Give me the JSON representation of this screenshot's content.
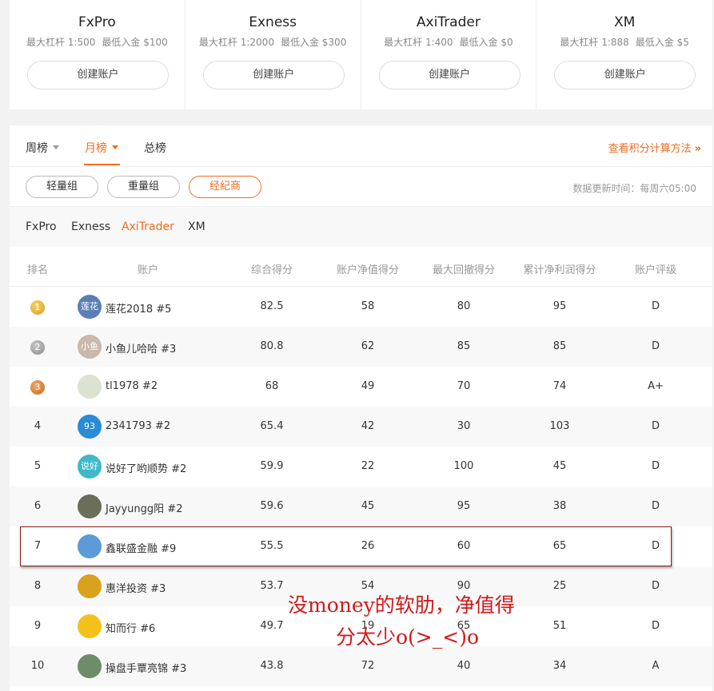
{
  "brokers": [
    {
      "name": "FxPro",
      "leverage": "最大杠杆 1:500",
      "min_deposit": "最低入金 $100",
      "button": "创建账户"
    },
    {
      "name": "Exness",
      "leverage": "最大杠杆 1:2000",
      "min_deposit": "最低入金 $300",
      "button": "创建账户"
    },
    {
      "name": "AxiTrader",
      "leverage": "最大杠杆 1:400",
      "min_deposit": "最低入金 $0",
      "button": "创建账户"
    },
    {
      "name": "XM",
      "leverage": "最大杠杆 1:888",
      "min_deposit": "最低入金 $5",
      "button": "创建账户"
    }
  ],
  "tabs": {
    "weekly": "周榜",
    "monthly": "月榜",
    "overall": "总榜",
    "active": "monthly"
  },
  "score_link": {
    "label": "查看积分计算方法",
    "arrows": "»"
  },
  "groups": {
    "light": "轻量组",
    "heavy": "重量组",
    "broker": "经纪商",
    "active": "broker"
  },
  "update_time": "数据更新时间：每周六05:00",
  "broker_filters": {
    "items": [
      "FxPro",
      "Exness",
      "AxiTrader",
      "XM"
    ],
    "active": "AxiTrader"
  },
  "table": {
    "headers": {
      "rank": "排名",
      "account": "账户",
      "total": "综合得分",
      "nav": "账户净值得分",
      "drawdown": "最大回撤得分",
      "pnl": "累计净利润得分",
      "grade": "账户评级"
    },
    "rows": [
      {
        "rank": "1",
        "medal": "gold",
        "avatar_text": "莲花",
        "avatar_color": "#5b7fb5",
        "account": "莲花2018 #5",
        "total": "82.5",
        "nav": "58",
        "drawdown": "80",
        "pnl": "95",
        "grade": "D"
      },
      {
        "rank": "2",
        "medal": "silver",
        "avatar_text": "小鱼",
        "avatar_color": "#c9b9ad",
        "account": "小鱼儿哈哈 #3",
        "total": "80.8",
        "nav": "62",
        "drawdown": "85",
        "pnl": "85",
        "grade": "D"
      },
      {
        "rank": "3",
        "medal": "bronze",
        "avatar_text": "",
        "avatar_color": "#d9e3cf",
        "account": "tl1978 #2",
        "total": "68",
        "nav": "49",
        "drawdown": "70",
        "pnl": "74",
        "grade": "A+"
      },
      {
        "rank": "4",
        "medal": "",
        "avatar_text": "93",
        "avatar_color": "#2a8bd6",
        "account": "2341793 #2",
        "total": "65.4",
        "nav": "42",
        "drawdown": "30",
        "pnl": "103",
        "grade": "D"
      },
      {
        "rank": "5",
        "medal": "",
        "avatar_text": "说好",
        "avatar_color": "#3fb8c8",
        "account": "说好了哟顺势 #2",
        "total": "59.9",
        "nav": "22",
        "drawdown": "100",
        "pnl": "45",
        "grade": "D"
      },
      {
        "rank": "6",
        "medal": "",
        "avatar_text": "",
        "avatar_color": "#6b6f5a",
        "account": "Jayyungg阳 #2",
        "total": "59.6",
        "nav": "45",
        "drawdown": "95",
        "pnl": "38",
        "grade": "D"
      },
      {
        "rank": "7",
        "medal": "",
        "avatar_text": "",
        "avatar_color": "#5b9bd8",
        "account": "鑫联盛金融 #9",
        "total": "55.5",
        "nav": "26",
        "drawdown": "60",
        "pnl": "65",
        "grade": "D"
      },
      {
        "rank": "8",
        "medal": "",
        "avatar_text": "",
        "avatar_color": "#d9a21e",
        "account": "惠洋投资 #3",
        "total": "53.7",
        "nav": "54",
        "drawdown": "90",
        "pnl": "25",
        "grade": "D"
      },
      {
        "rank": "9",
        "medal": "",
        "avatar_text": "",
        "avatar_color": "#f3c21a",
        "account": "知而行 #6",
        "total": "49.7",
        "nav": "19",
        "drawdown": "65",
        "pnl": "51",
        "grade": "D"
      },
      {
        "rank": "10",
        "medal": "",
        "avatar_text": "",
        "avatar_color": "#6f8c6a",
        "account": "操盘手覃亮锦 #3",
        "total": "43.8",
        "nav": "72",
        "drawdown": "40",
        "pnl": "34",
        "grade": "A"
      }
    ]
  },
  "annotation": {
    "line1": "没money的软肋，净值得",
    "line2": "分太少o(>_<)o"
  }
}
